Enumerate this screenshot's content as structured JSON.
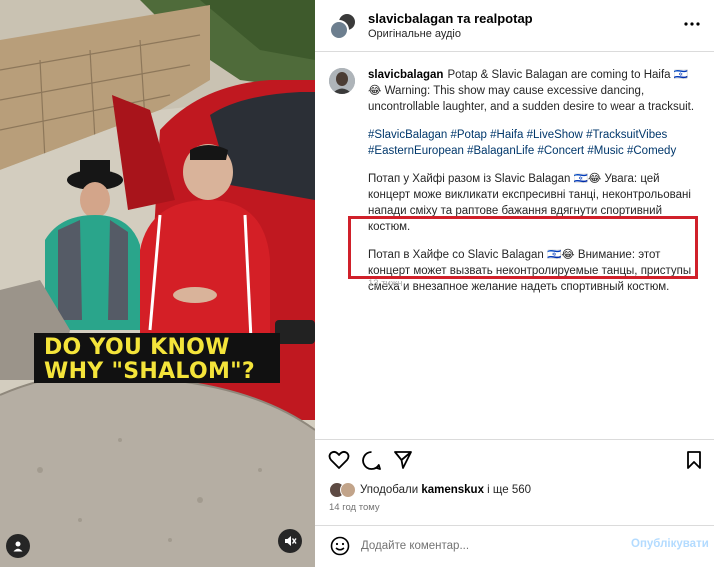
{
  "header": {
    "title_user1": "slavicbalagan",
    "title_connector": " та ",
    "title_user2": "realpotap",
    "audio": "Оригінальне аудіо"
  },
  "media": {
    "caption_line1": "DO YOU KNOW",
    "caption_line2": "WHY \"SHALOM\"?"
  },
  "post": {
    "username": "slavicbalagan",
    "intro": "Potap & Slavic Balagan are coming to Haifa 🇮🇱😂 Warning: This show may cause excessive dancing, uncontrollable laughter, and a sudden desire to wear a tracksuit.",
    "hashtags": [
      "#SlavicBalagan",
      "#Potap",
      "#Haifa",
      "#LiveShow",
      "#TracksuitVibes",
      "#EasternEuropean",
      "#BalaganLife",
      "#Concert",
      "#Music",
      "#Comedy"
    ],
    "ukrainian": "Потап у Хайфі разом із Slavic Balagan 🇮🇱😂 Увага: цей концерт може викликати експресивні танці, неконтрольовані напади сміху та раптове бажання вдягнути спортивний костюм.",
    "russian": "Потап в Хайфе со Slavic Balagan 🇮🇱😂 Внимание: этот концерт может вызвать неконтролируемые танцы, приступы смеха и внезапное желание надеть спортивный костюм.",
    "edited_ghost": "13 тижн."
  },
  "likes": {
    "prefix": "Уподобали ",
    "user": "kamenskux",
    "suffix": " і ще 560"
  },
  "time_ago": "14 год тому",
  "comment": {
    "placeholder": "Додайте коментар...",
    "publish": "Опублікувати"
  },
  "colors": {
    "highlight_border": "#d0202a",
    "hashtag": "#00376b",
    "publish_disabled": "#b3dbff"
  },
  "icons": [
    "more-icon",
    "heart-icon",
    "comment-icon",
    "share-icon",
    "bookmark-icon",
    "emoji-icon",
    "user-tag-icon",
    "mute-icon"
  ]
}
